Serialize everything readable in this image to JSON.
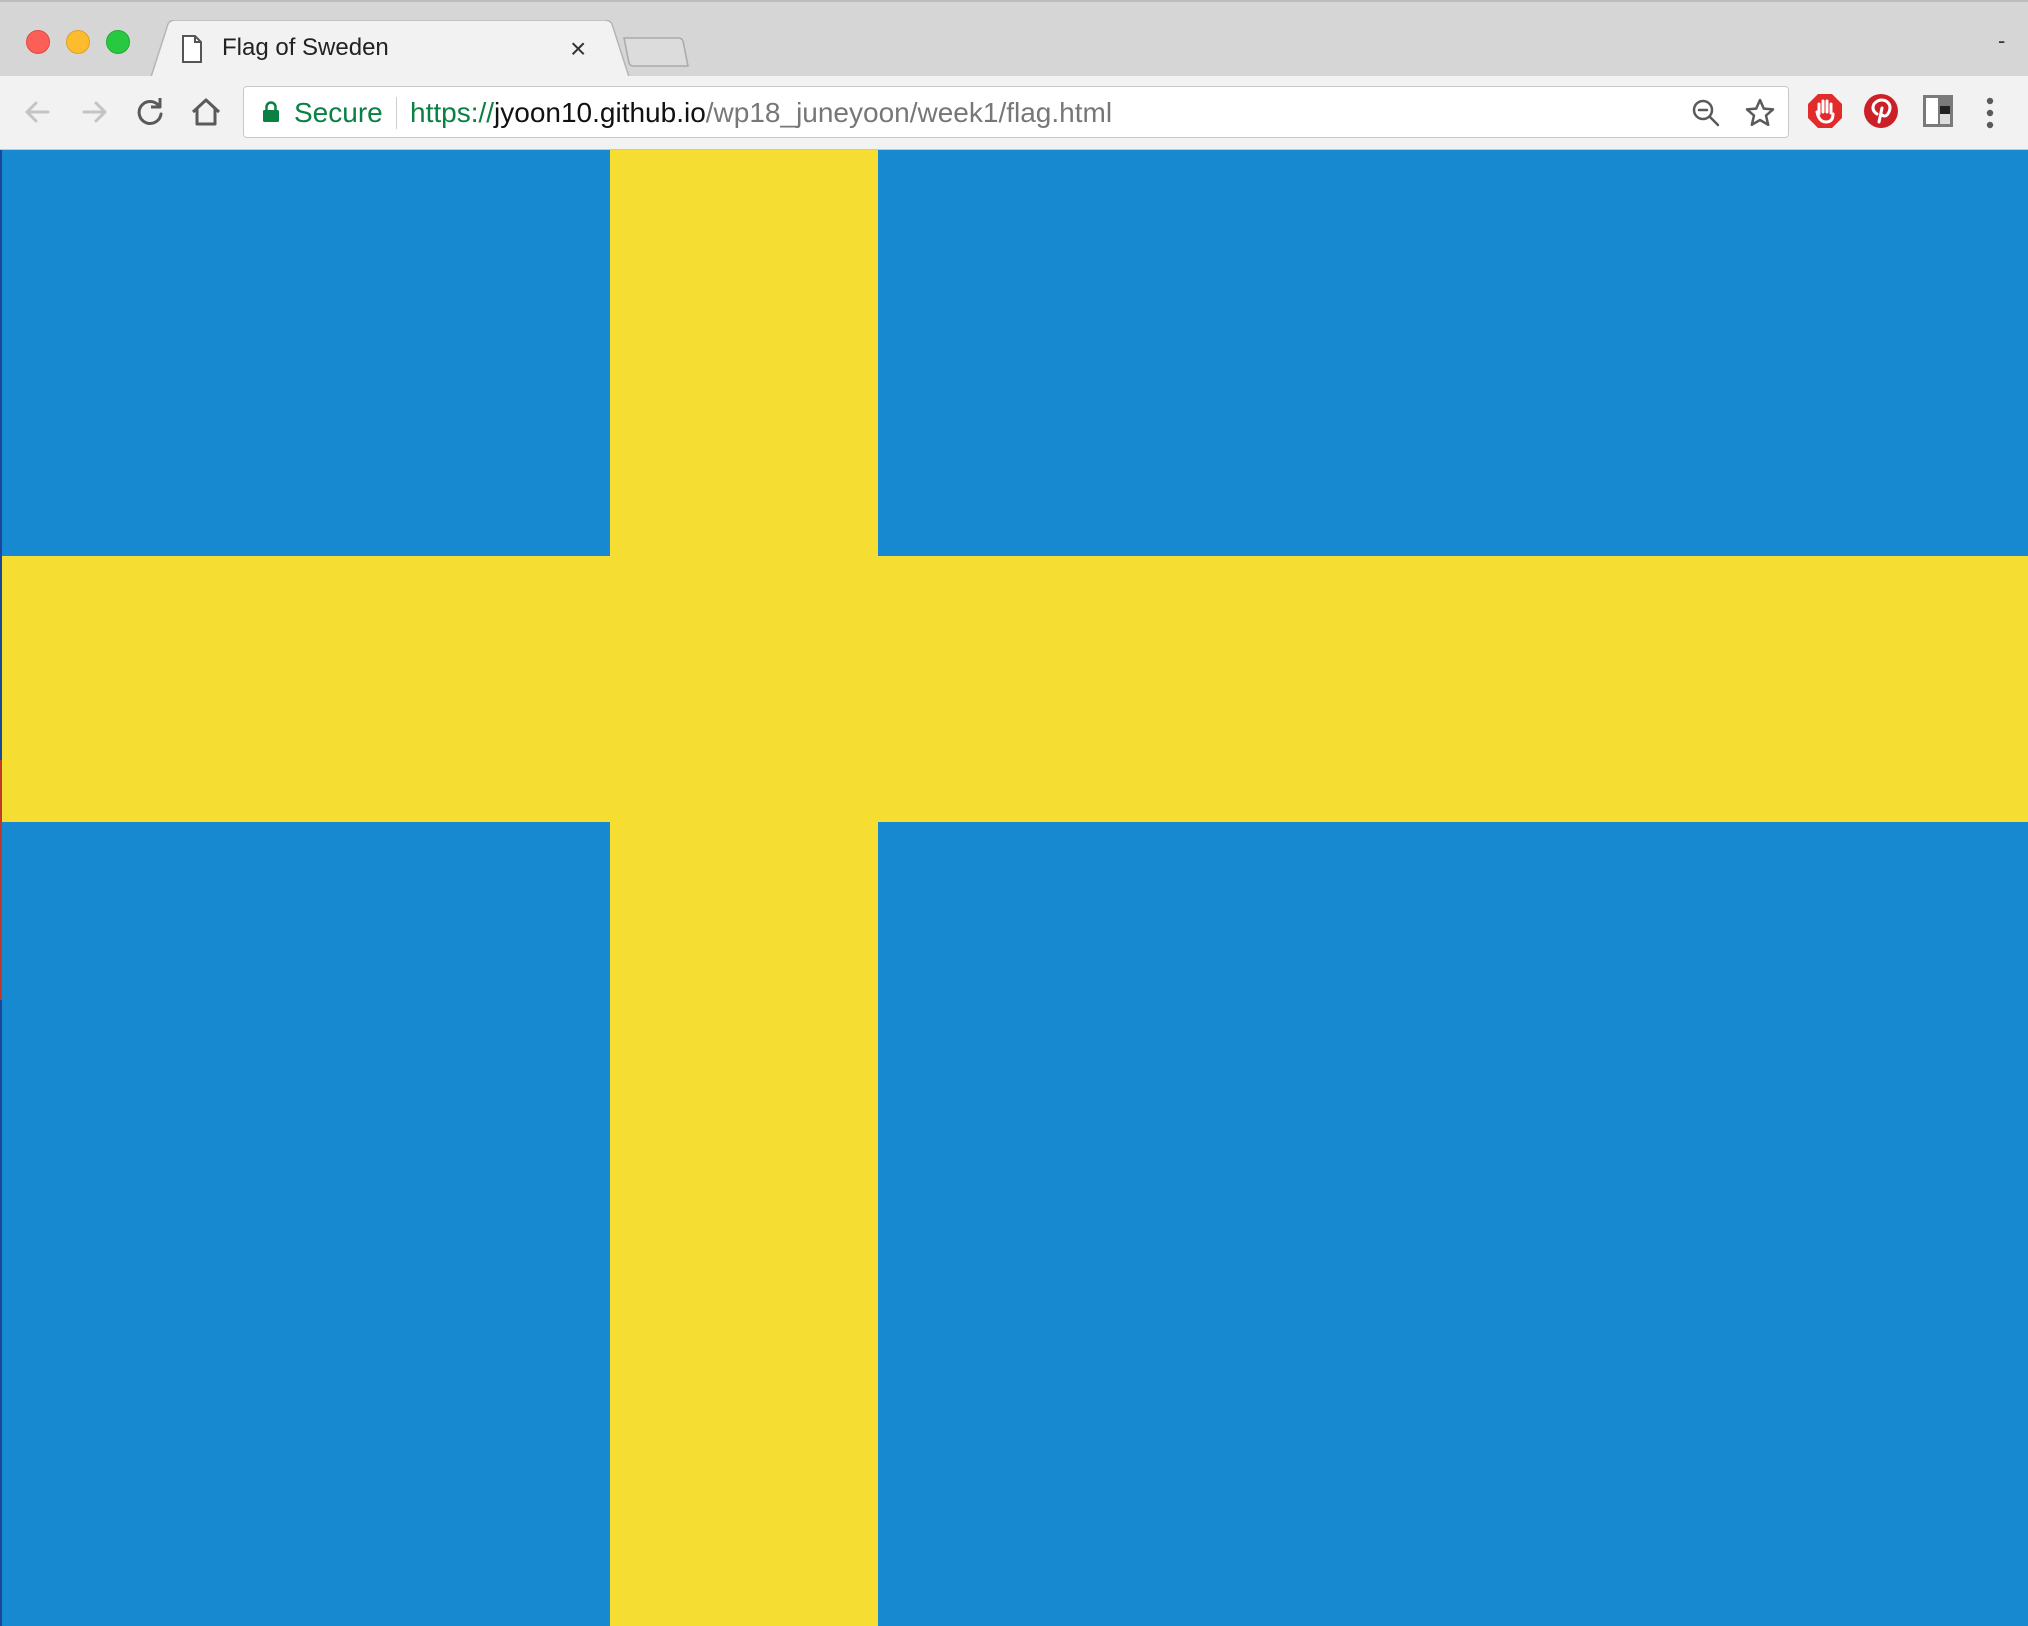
{
  "browser": {
    "tab": {
      "title": "Flag of Sweden",
      "close_glyph": "×",
      "favicon": "page-icon"
    },
    "window_menu_glyph": "-",
    "toolbar": {
      "back_icon": "arrow-left-icon",
      "forward_icon": "arrow-right-icon",
      "reload_icon": "reload-icon",
      "home_icon": "home-icon"
    },
    "omnibox": {
      "secure_label": "Secure",
      "url_scheme": "https://",
      "url_host": "jyoon10.github.io",
      "url_path": "/wp18_juneyoon/week1/flag.html",
      "zoom_icon": "zoom-out-icon",
      "bookmark_icon": "star-icon"
    },
    "extensions": [
      "adblock-icon",
      "pinterest-icon",
      "extension-icon"
    ],
    "menu_icon": "more-vert-icon"
  },
  "page": {
    "flag": {
      "blue": "#1789d0",
      "yellow": "#f5dd31"
    }
  },
  "colors": {
    "secure_green": "#0b8043"
  }
}
